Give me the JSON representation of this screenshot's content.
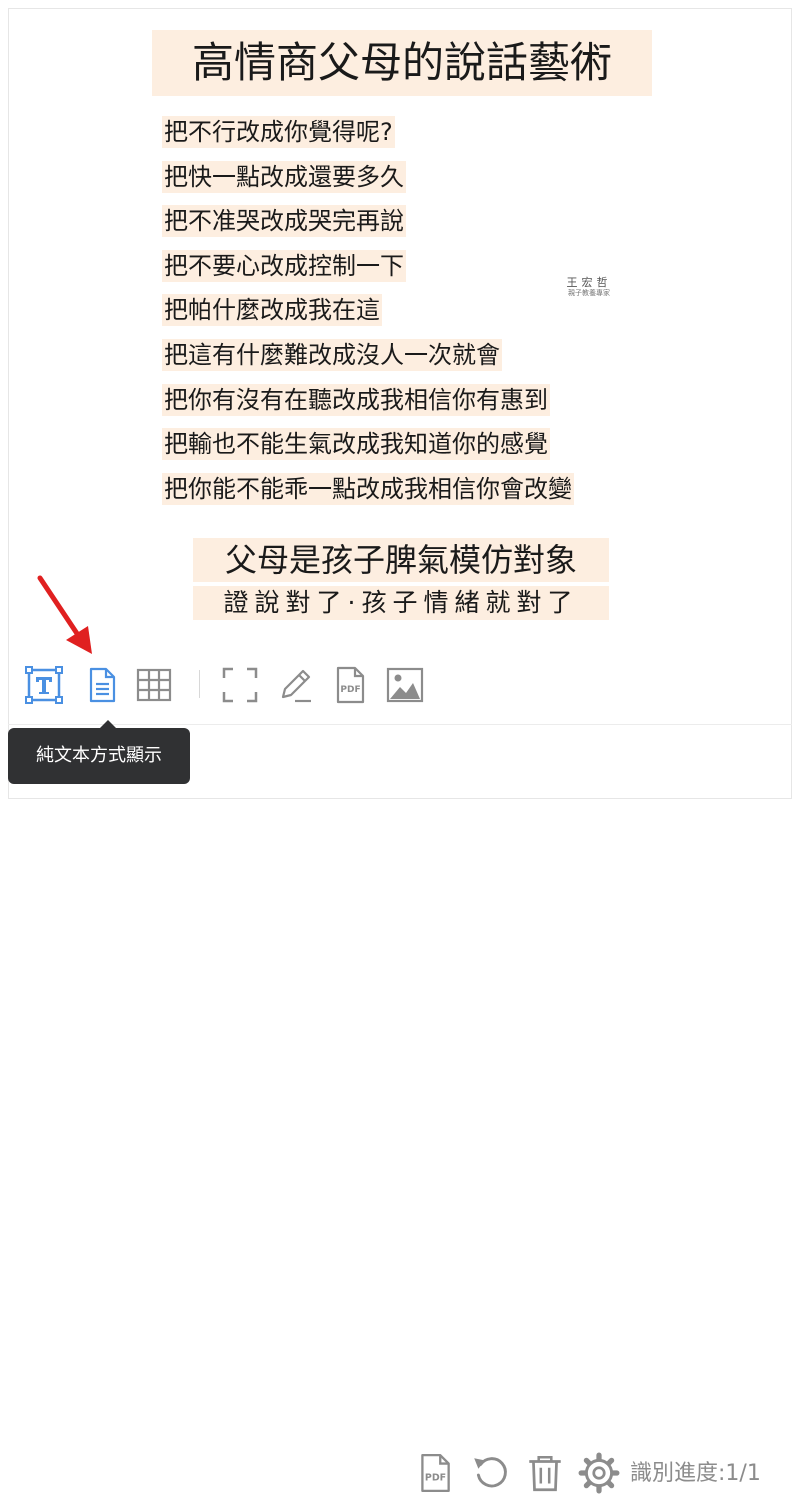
{
  "document": {
    "title": "高情商父母的說話藝術",
    "lines": [
      "把不行改成你覺得呢?",
      "把快一點改成還要多久",
      "把不准哭改成哭完再說",
      "把不要心改成控制一下",
      "把帕什麼改成我在這",
      "把這有什麼難改成沒人一次就會",
      "把你有沒有在聽改成我相信你有惠到",
      "把輸也不能生氣改成我知道你的感覺",
      "把你能不能乖一點改成我相信你會改變"
    ],
    "subtitle": "父母是孩子脾氣模仿對象",
    "tagline": "證說對了·孩子情緒就對了",
    "stamp_name": "王宏哲",
    "stamp_sub": "親子教養專家"
  },
  "toolbar": {
    "icons": [
      "text-recognize-icon",
      "plain-text-icon",
      "table-icon",
      "fullscreen-icon",
      "edit-icon",
      "pdf-icon",
      "image-icon"
    ]
  },
  "tooltip": {
    "text": "純文本方式顯示"
  },
  "bottom_bar": {
    "icons": [
      "pdf-export-icon",
      "refresh-icon",
      "trash-icon",
      "settings-icon"
    ],
    "progress_label": "識別進度:1/1"
  },
  "colors": {
    "accent": "#4a90e2",
    "highlight": "#fdeee0",
    "icon_gray": "#8c8c8c",
    "tooltip_bg": "#303133",
    "arrow": "#e02020"
  }
}
